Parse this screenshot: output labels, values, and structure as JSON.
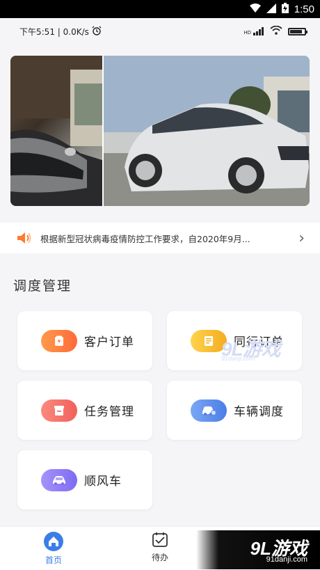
{
  "os_status": {
    "time": "1:50",
    "icons": [
      "wifi-icon",
      "signal-icon",
      "battery-full-icon"
    ]
  },
  "app_status": {
    "left_text": "下午5:51 | 0.0K/s",
    "alarm_icon": "alarm-icon",
    "right_icons": [
      "hd-signal-icon",
      "wifi-icon",
      "battery-icon"
    ],
    "hd_label": "HD",
    "battery_level": 0.85
  },
  "banner": {
    "images": [
      "car-front-closeup",
      "silver-sedan"
    ]
  },
  "notice": {
    "text": "根据新型冠状病毒疫情防控工作要求，自2020年9月...",
    "icon": "speaker-icon",
    "arrow": "›"
  },
  "section": {
    "title": "调度管理"
  },
  "menu": [
    {
      "label": "客户订单",
      "icon": "order-icon",
      "color": "#ff7a45"
    },
    {
      "label": "同行订单",
      "icon": "document-icon",
      "color": "#fbbf24"
    },
    {
      "label": "任务管理",
      "icon": "task-icon",
      "color": "#f7736b"
    },
    {
      "label": "车辆调度",
      "icon": "car-dispatch-icon",
      "color": "#5b8def"
    },
    {
      "label": "顺风车",
      "icon": "car-icon",
      "color": "#8b7cf6"
    }
  ],
  "watermark_mid": {
    "title": "9L游戏",
    "sub": "91danji.com"
  },
  "tabbar": {
    "tabs": [
      {
        "label": "首页",
        "icon": "home-icon",
        "active": true,
        "color": "#3b7ee8"
      },
      {
        "label": "待办",
        "icon": "todo-icon",
        "active": false,
        "color": "#333333"
      }
    ]
  },
  "watermark_corner": {
    "title": "9L游戏",
    "sub": "91danji.com"
  }
}
